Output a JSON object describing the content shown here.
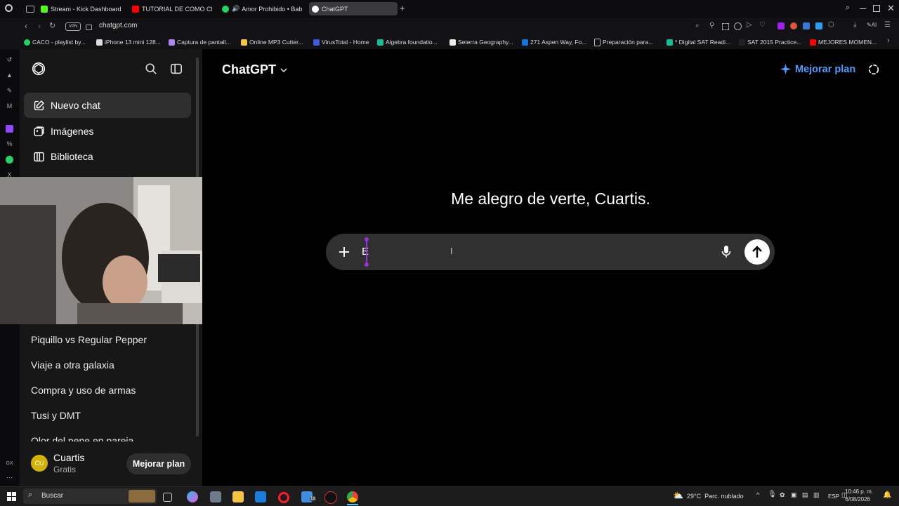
{
  "browser": {
    "tabs": [
      {
        "label": "Stream - Kick Dashboard",
        "color": "#53fc18"
      },
      {
        "label": "TUTORIAL DE COMO CREA",
        "color": "#ff0000"
      },
      {
        "label": "Amor Prohibido • Baby",
        "color": "#1ed760"
      },
      {
        "label": "ChatGPT",
        "color": "#ffffff"
      }
    ],
    "vpn_label": "VPN",
    "url": "chatgpt.com",
    "bookmarks": [
      "CACO - playlist by...",
      "iPhone 13 mini 128...",
      "Captura de pantall...",
      "Online MP3 Cutter...",
      "VirusTotal - Home",
      "Algebra foundatio...",
      "Seterra Geography...",
      "271 Aspen Way, Fo...",
      "Preparación para...",
      "* Digital SAT Readi...",
      "SAT 2015 Practice...",
      "MEJORES MOMEN..."
    ]
  },
  "sidebar": {
    "nav": [
      {
        "label": "Nuevo chat",
        "icon": "edit-icon"
      },
      {
        "label": "Imágenes",
        "icon": "images-icon"
      },
      {
        "label": "Biblioteca",
        "icon": "library-icon"
      }
    ],
    "history": [
      "Piquillo vs Regular Pepper",
      "Viaje a otra galaxia",
      "Compra y uso de armas",
      "Tusi y DMT",
      "Olor del pene en pareja"
    ],
    "user": {
      "initials": "CU",
      "name": "Cuartis",
      "plan": "Gratis",
      "upgrade_label": "Mejorar plan"
    }
  },
  "main": {
    "model_label": "ChatGPT",
    "upgrade_label": "Mejorar plan",
    "greeting": "Me alegro de verte, Cuartis.",
    "composer_value": "E"
  },
  "taskbar": {
    "search_placeholder": "Buscar",
    "weather": "29°C  Parc. nublado",
    "lang": "ESP",
    "time": "10:46 p. m.",
    "date": "6/08/2026",
    "mail_badge": "18"
  },
  "colors": {
    "accent": "#4a9eff",
    "sidebar": "#171717",
    "composer": "#303030"
  }
}
